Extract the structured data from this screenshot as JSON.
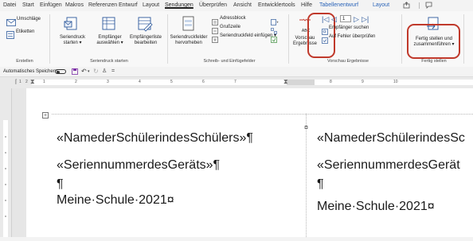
{
  "menu": {
    "items": [
      {
        "label": "Datei"
      },
      {
        "label": "Start"
      },
      {
        "label": "Einfügen"
      },
      {
        "label": "Makros"
      },
      {
        "label": "Referenzen"
      },
      {
        "label": "Entwurf"
      },
      {
        "label": "Layout"
      },
      {
        "label": "Sendungen"
      },
      {
        "label": "Überprüfen"
      },
      {
        "label": "Ansicht"
      },
      {
        "label": "Entwicklertools"
      },
      {
        "label": "Hilfe"
      },
      {
        "label": "Tabellenentwurf"
      },
      {
        "label": "Layout"
      }
    ],
    "active_index": 7
  },
  "ribbon": {
    "erstellen": {
      "umschlaege": "Umschläge",
      "etiketten": "Etiketten",
      "group": "Erstellen"
    },
    "seriendruck_starten": {
      "btn1_line1": "Seriendruck",
      "btn1_line2": "starten",
      "btn2_line1": "Empfänger",
      "btn2_line2": "auswählen",
      "btn3_line1": "Empfängerliste",
      "btn3_line2": "bearbeiten",
      "group": "Seriendruck starten"
    },
    "schreib_felder": {
      "hervorheben_line1": "Seriendruckfelder",
      "hervorheben_line2": "hervorheben",
      "adressblock": "Adressblock",
      "grusszeile": "Grußzeile",
      "feld_einfuegen": "Seriendruckfeld einfügen",
      "group": "Schreib- und Einfügefelder"
    },
    "vorschau": {
      "abc": "ABC",
      "vorschau_line1": "Vorschau",
      "vorschau_line2": "Ergebnisse",
      "record_value": "1",
      "empfaenger_suchen": "Empfänger suchen",
      "auf_fehler": "Auf Fehler überprüfen",
      "group": "Vorschau Ergebnisse"
    },
    "fertig": {
      "line1": "Fertig stellen und",
      "line2": "zusammenführen",
      "group": "Fertig stellen"
    }
  },
  "qat": {
    "autosave_label": "Automatisches Speichern"
  },
  "ruler_numbers": [
    "1",
    "2",
    "1",
    "2",
    "3",
    "4",
    "5",
    "6",
    "7",
    "8",
    "9",
    "10"
  ],
  "document": {
    "left": {
      "line1": "«NamederSchülerindesSchülers»¶",
      "line2": "«SeriennummerdesGeräts»¶",
      "line3": "¶",
      "line4": "Meine·Schule·2021¤"
    },
    "right": {
      "line1": "«NamederSchülerindesSc",
      "line2": "«SeriennummerdesGerät",
      "line3": "¶",
      "line4": "Meine·Schule·2021¤"
    }
  },
  "colors": {
    "highlight": "#c0392b",
    "contextual_tab": "#2b64b8",
    "accent": "#2b579a"
  }
}
